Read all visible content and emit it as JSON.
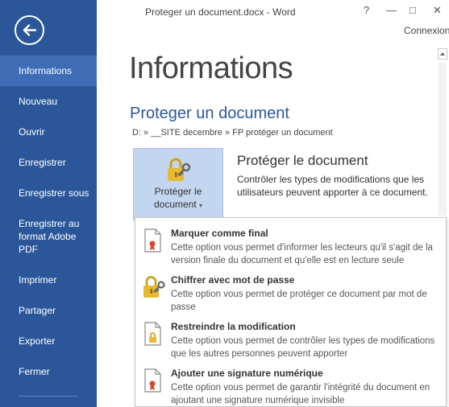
{
  "window": {
    "title": "Proteger un document.docx - Word",
    "help_glyph": "?",
    "minimize_glyph": "—",
    "restore_glyph": "□",
    "close_glyph": "✕",
    "account_label": "Connexion"
  },
  "colors": {
    "sidebar": "#2b579a",
    "sidebar_active": "#3e6db5",
    "accent": "#2b579a",
    "protect_button": "#c3d6ef"
  },
  "sidebar": {
    "back_icon": "back-arrow-icon",
    "items": [
      {
        "label": "Informations",
        "active": true
      },
      {
        "label": "Nouveau"
      },
      {
        "label": "Ouvrir"
      },
      {
        "label": "Enregistrer"
      },
      {
        "label": "Enregistrer sous"
      },
      {
        "label": "Enregistrer au format Adobe PDF"
      },
      {
        "label": "Imprimer"
      },
      {
        "label": "Partager"
      },
      {
        "label": "Exporter"
      },
      {
        "label": "Fermer"
      }
    ]
  },
  "main": {
    "page_title": "Informations",
    "document_title": "Proteger un document",
    "document_path": "D: » __SITE decembre » FP protéger un document"
  },
  "protect": {
    "button_line1": "Protéger le",
    "button_line2": "document",
    "button_chevron": "▾",
    "title": "Protéger le document",
    "description": "Contrôler les types de modifications que les utilisateurs peuvent apporter à ce document."
  },
  "menu": {
    "items": [
      {
        "label": "Marquer comme final",
        "description": "Cette option vous permet d'informer les lecteurs qu'il s'agit de la version finale du document et qu'elle est en lecture seule",
        "icon": "document-final-icon"
      },
      {
        "label": "Chiffrer avec mot de passe",
        "description": "Cette option vous permet de protéger ce document par mot de passe",
        "icon": "lock-key-icon"
      },
      {
        "label": "Restreindre la modification",
        "description": "Cette option vous permet de contrôler les types de modifications que les autres personnes peuvent apporter",
        "icon": "document-lock-icon"
      },
      {
        "label": "Ajouter une signature numérique",
        "description": "Cette option vous permet de garantir l'intégrité du document en ajoutant une signature numérique invisible",
        "icon": "document-signature-icon"
      }
    ]
  }
}
